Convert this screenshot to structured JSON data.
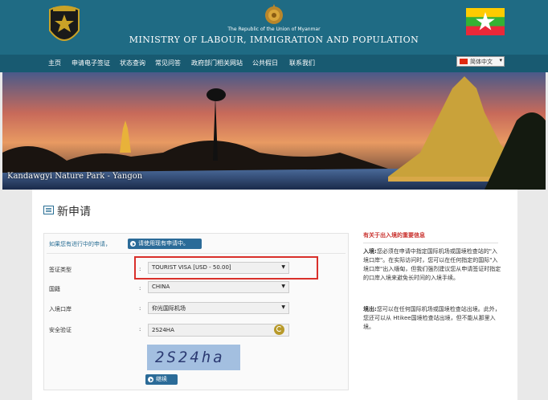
{
  "header": {
    "logo_text": "IMMIGRATION",
    "subtitle": "The Republic of the Union of Myanmar",
    "title": "MINISTRY OF  LABOUR, IMMIGRATION AND POPULATION"
  },
  "nav": {
    "items": [
      "主页",
      "申请电子签证",
      "状态查询",
      "常见问答",
      "政府部门相关网站",
      "公共假日",
      "联系我们"
    ],
    "language": "简体中文"
  },
  "banner": {
    "caption": "Kandawgyi Nature Park - Yangon"
  },
  "page": {
    "title": "新申请"
  },
  "form": {
    "existing_question": "如果您有进行中的申请，",
    "existing_button": "请使用现有申请中。",
    "visa_type_label": "签证类型",
    "visa_type_value": "TOURIST VISA [USD - 50.00]",
    "nationality_label": "国籍",
    "nationality_value": "CHINA",
    "entry_port_label": "入境口岸",
    "entry_port_value": "仰光国际机场",
    "captcha_label": "安全验证",
    "captcha_value": "2S24HA",
    "captcha_image_text": "2S24ha",
    "colon": ":",
    "continue_button": "继续"
  },
  "sidebar": {
    "title": "有关于出入境的重要信息",
    "entry_heading": "入境:",
    "entry_text": "您必须在申请中指定国际机场或国境检查站的\"入境口岸\"。在实际访问时，您可以在任何指定的国际\"入境口岸\"出入缅甸，但我们强烈建议您从申请签证时指定的口岸入境来避免长时间的入境手续。",
    "exit_heading": "境出:",
    "exit_text": "您可以在任何国际机场或国境检查站出境。此外，您还可以从 Htikee国境检查站出境，但不能从那里入境。"
  },
  "colors": {
    "header_bg": "#1f6b84",
    "nav_bg": "#185a71",
    "accent_blue": "#2b6b98",
    "highlight_red": "#d9302b"
  }
}
